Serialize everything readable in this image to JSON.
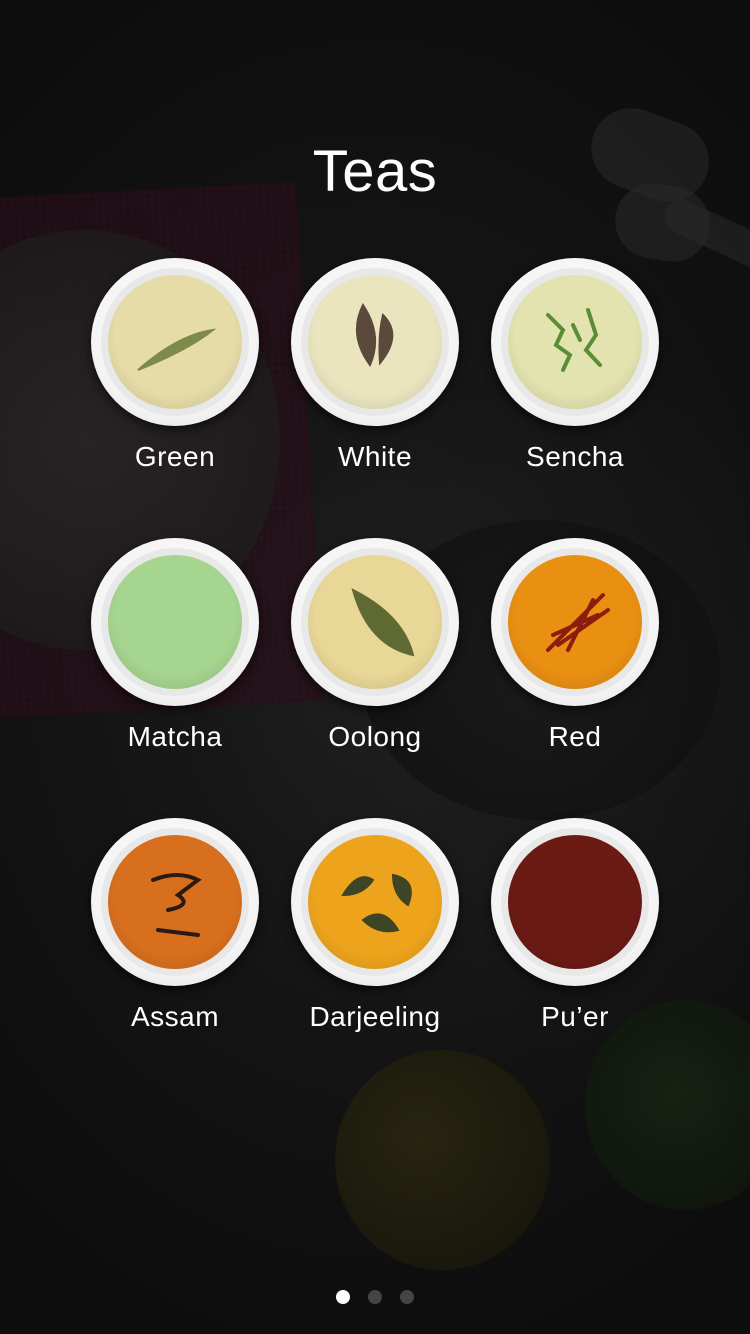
{
  "screen": {
    "title": "Teas"
  },
  "teas": [
    {
      "label": "Green",
      "liquid": "#e6dca8",
      "leaf": "#7d8a4a"
    },
    {
      "label": "White",
      "liquid": "#ebe5bf",
      "leaf": "#5b4a3c"
    },
    {
      "label": "Sencha",
      "liquid": "#e3e3b0",
      "leaf": "#5a8d35"
    },
    {
      "label": "Matcha",
      "liquid": "#a6d58f",
      "leaf": "#8bc277"
    },
    {
      "label": "Oolong",
      "liquid": "#e8d796",
      "leaf": "#5e6a32"
    },
    {
      "label": "Red",
      "liquid": "#e98f12",
      "leaf": "#8c1c0d"
    },
    {
      "label": "Assam",
      "liquid": "#d86f1e",
      "leaf": "#2b1a10"
    },
    {
      "label": "Darjeeling",
      "liquid": "#eda41c",
      "leaf": "#3d4524"
    },
    {
      "label": "Pu’er",
      "liquid": "#6b1a14",
      "leaf": "#3a0c08"
    }
  ],
  "pager": {
    "page_count": 3,
    "active_index": 0
  }
}
